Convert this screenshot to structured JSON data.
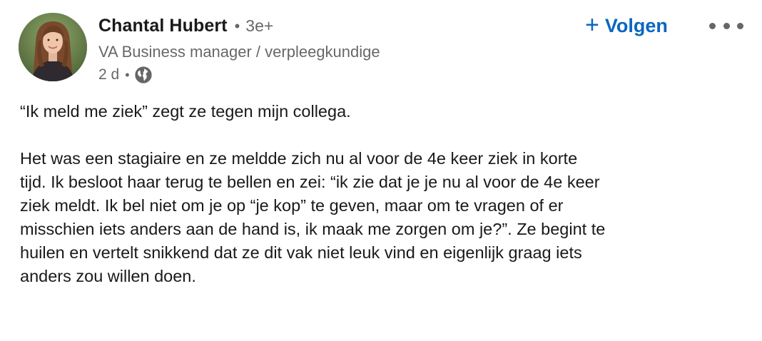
{
  "post": {
    "author": {
      "name": "Chantal Hubert",
      "separator": "•",
      "degree": "3e+",
      "headline": "VA Business manager / verpleegkundige",
      "time": "2 d",
      "meta_separator": "•",
      "visibility_icon": "globe-icon"
    },
    "follow": {
      "icon": "plus-icon",
      "label": "Volgen"
    },
    "more_icon": "more-options-icon",
    "paragraphs": [
      "“Ik meld me ziek” zegt ze tegen mijn collega.",
      "Het was een stagiaire en ze meldde zich nu al voor de 4e keer ziek in korte\ntijd. Ik besloot haar terug te bellen en zei: “ik zie dat je je nu al voor de 4e keer\nziek meldt. Ik bel niet om je op “je kop” te geven, maar om te vragen of er\nmisschien iets anders aan de hand is, ik maak me zorgen om je?”. Ze begint te\nhuilen en vertelt snikkend dat ze dit vak niet leuk vind en eigenlijk graag iets\nanders zou willen doen."
    ]
  },
  "colors": {
    "accent": "#0a66c2",
    "text": "#1f1f1f",
    "muted": "#666666"
  }
}
